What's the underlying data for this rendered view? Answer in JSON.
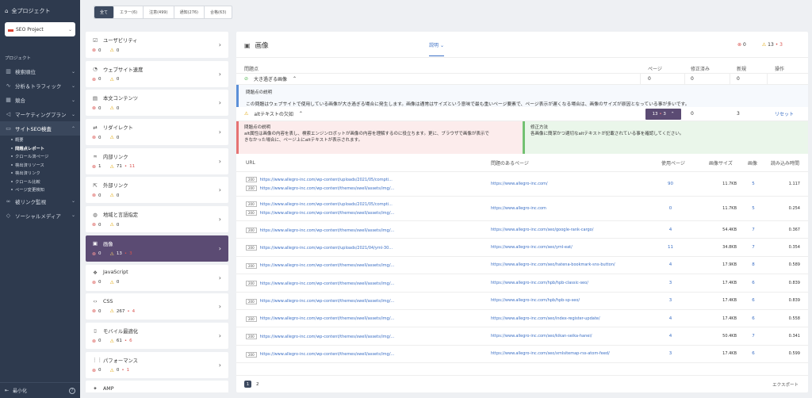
{
  "sidebar": {
    "all_projects": "全プロジェクト",
    "project_name": "SEO Project",
    "section": "プロジェクト",
    "items": [
      {
        "icon": "chart-icon",
        "label": "検索順位"
      },
      {
        "icon": "trend-icon",
        "label": "分析＆トラフィック"
      },
      {
        "icon": "grid-icon",
        "label": "競合"
      },
      {
        "icon": "megaphone-icon",
        "label": "マーケティングプラン"
      },
      {
        "icon": "monitor-icon",
        "label": "サイトSEO検査"
      },
      {
        "icon": "link-icon",
        "label": "被リンク監視"
      },
      {
        "icon": "share-icon",
        "label": "ソーシャルメディア"
      }
    ],
    "subitems": [
      "概要",
      "問題点レポート",
      "クロール済ページ",
      "検出済リソース",
      "検出済リンク",
      "クロール比較",
      "ページ変更検知"
    ],
    "minimize": "最小化"
  },
  "filters": [
    "全て",
    "エラー(6)",
    "注意(499)",
    "通知(276)",
    "合格(63)"
  ],
  "categories": [
    {
      "icon": "checkbox-icon",
      "title": "ユーザビリティ",
      "err": "0",
      "warn": "0",
      "extra": ""
    },
    {
      "icon": "speed-icon",
      "title": "ウェブサイト速度",
      "err": "0",
      "warn": "0",
      "extra": ""
    },
    {
      "icon": "document-icon",
      "title": "本文コンテンツ",
      "err": "0",
      "warn": "0",
      "extra": ""
    },
    {
      "icon": "redirect-icon",
      "title": "リダイレクト",
      "err": "0",
      "warn": "0",
      "extra": ""
    },
    {
      "icon": "link-icon",
      "title": "内部リンク",
      "err": "1",
      "warn": "71",
      "extra": "11"
    },
    {
      "icon": "external-link-icon",
      "title": "外部リンク",
      "err": "0",
      "warn": "0",
      "extra": ""
    },
    {
      "icon": "globe-icon",
      "title": "地域と言語指定",
      "err": "0",
      "warn": "0",
      "extra": ""
    },
    {
      "icon": "image-icon",
      "title": "画像",
      "err": "0",
      "warn": "13",
      "extra": "3"
    },
    {
      "icon": "js-icon",
      "title": "JavaScript",
      "err": "0",
      "warn": "0",
      "extra": ""
    },
    {
      "icon": "code-icon",
      "title": "CSS",
      "err": "0",
      "warn": "267",
      "extra": "4"
    },
    {
      "icon": "mobile-icon",
      "title": "モバイル最適化",
      "err": "0",
      "warn": "61",
      "extra": "6"
    },
    {
      "icon": "performance-icon",
      "title": "パフォーマンス",
      "err": "0",
      "warn": "0",
      "extra": "1"
    },
    {
      "icon": "amp-icon",
      "title": "AMP",
      "err": "0",
      "warn": "0",
      "extra": ""
    }
  ],
  "main": {
    "title": "画像",
    "desc_tab": "説明",
    "err_count": "0",
    "warn_count": "13",
    "warn_extra": "3",
    "cols": {
      "issue": "問題点",
      "page": "ページ",
      "fixed": "修正済み",
      "new": "新規",
      "action": "操作"
    },
    "row1": {
      "label": "大き過ぎる画像",
      "page": "0",
      "fixed": "0",
      "new": "0"
    },
    "info1": {
      "label": "問題点の説明",
      "text": "この問題はウェブサイトで使用している画像が大き過ぎる場合に発生します。画像は通常はサイズという意味で最も重いページ要素で、ページ表示が遅くなる場合は、画像のサイズが原因となっている事が多いです。"
    },
    "row2": {
      "label": "altテキストの欠如",
      "badge": "13",
      "badge_extra": "3",
      "fixed": "0",
      "new": "3",
      "reset": "リセット"
    },
    "issue_desc": {
      "label": "問題点の説明",
      "text1": "alt属性は画像の内容を表し、検索エンジンロボットが画像の内容を理解するのに役立ちます。更に、ブラウザで画像が表示で",
      "text2": "きなかった場合に、ページ上にaltテキストが表示されます。"
    },
    "fix": {
      "label": "修正方法",
      "text": "各画像に簡潔かつ適切なaltテキストが記載されている事を確認してください。"
    },
    "url_cols": {
      "url": "URL",
      "page": "問題のあるページ",
      "used": "使用ページ",
      "size": "画像サイズ",
      "img": "画像",
      "time": "読み込み時間"
    },
    "rows": [
      {
        "tag": "200",
        "urls": [
          "https://www.allegro-inc.com/wp-content/uploads/2021/05/compti...",
          "https://www.allegro-inc.com/wp-content/themes/swell/assets/img/..."
        ],
        "page": "https://www.allegro-inc.com/",
        "used": "90",
        "size": "11.7KB",
        "img": "5",
        "time": "1.117"
      },
      {
        "tag": "200",
        "urls": [
          "https://www.allegro-inc.com/wp-content/uploads/2021/05/compti...",
          "https://www.allegro-inc.com/wp-content/themes/swell/assets/img/..."
        ],
        "page": "https://www.allegro-inc.com",
        "used": "0",
        "size": "11.7KB",
        "img": "5",
        "time": "0.254"
      },
      {
        "tag": "200",
        "urls": [
          "https://www.allegro-inc.com/wp-content/themes/swell/assets/img/..."
        ],
        "page": "https://www.allegro-inc.com/seo/google-rank-cargo/",
        "used": "4",
        "size": "54.4KB",
        "img": "7",
        "time": "0.367"
      },
      {
        "tag": "200",
        "urls": [
          "https://www.allegro-inc.com/wp-content/uploads/2021/04/yml-30..."
        ],
        "page": "https://www.allegro-inc.com/seo/yml-eat/",
        "used": "11",
        "size": "34.8KB",
        "img": "7",
        "time": "0.354"
      },
      {
        "tag": "200",
        "urls": [
          "https://www.allegro-inc.com/wp-content/themes/swell/assets/img/..."
        ],
        "page": "https://www.allegro-inc.com/seo/hatena-bookmark-sns-button/",
        "used": "4",
        "size": "17.9KB",
        "img": "8",
        "time": "0.589"
      },
      {
        "tag": "200",
        "urls": [
          "https://www.allegro-inc.com/wp-content/themes/swell/assets/img/..."
        ],
        "page": "https://www.allegro-inc.com/hpb/hpb-classic-seo/",
        "used": "3",
        "size": "17.4KB",
        "img": "6",
        "time": "0.839"
      },
      {
        "tag": "200",
        "urls": [
          "https://www.allegro-inc.com/wp-content/themes/swell/assets/img/..."
        ],
        "page": "https://www.allegro-inc.com/hpb/hpb-sp-seo/",
        "used": "3",
        "size": "17.4KB",
        "img": "6",
        "time": "0.839"
      },
      {
        "tag": "200",
        "urls": [
          "https://www.allegro-inc.com/wp-content/themes/swell/assets/img/..."
        ],
        "page": "https://www.allegro-inc.com/seo/index-register-update/",
        "used": "4",
        "size": "17.4KB",
        "img": "6",
        "time": "0.558"
      },
      {
        "tag": "200",
        "urls": [
          "https://www.allegro-inc.com/wp-content/themes/swell/assets/img/..."
        ],
        "page": "https://www.allegro-inc.com/seo/kikan-seika-hanei/",
        "used": "4",
        "size": "50.4KB",
        "img": "7",
        "time": "0.341"
      },
      {
        "tag": "200",
        "urls": [
          "https://www.allegro-inc.com/wp-content/themes/swell/assets/img/..."
        ],
        "page": "https://www.allegro-inc.com/seo/xmlsitemap-rss-atom-feed/",
        "used": "3",
        "size": "17.4KB",
        "img": "6",
        "time": "0.599"
      }
    ],
    "pages": [
      "1",
      "2"
    ],
    "export": "エクスポート"
  }
}
